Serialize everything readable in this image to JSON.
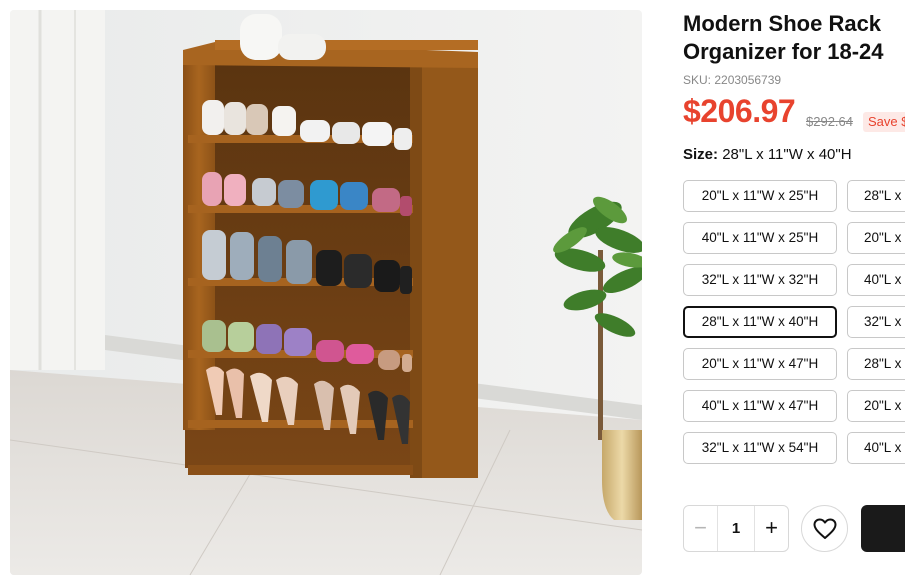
{
  "product": {
    "title_line1": "Modern Shoe Rack",
    "title_line2": "Organizer for 18-24",
    "sku": "SKU: 2203056739",
    "price": "$206.97",
    "original_price": "$292.64",
    "save_badge": "Save $",
    "image_alt": "Six-tier bamboo shoe rack filled with shoes"
  },
  "size": {
    "label": "Size:",
    "selected": "28\"L x 11\"W x 40\"H",
    "options": [
      {
        "label": "20\"L x 11\"W x 25\"H",
        "selected": false
      },
      {
        "label": "28\"L x",
        "selected": false
      },
      {
        "label": "40\"L x 11\"W x 25\"H",
        "selected": false
      },
      {
        "label": "20\"L x",
        "selected": false
      },
      {
        "label": "32\"L x 11\"W x 32\"H",
        "selected": false
      },
      {
        "label": "40\"L x",
        "selected": false
      },
      {
        "label": "28\"L x 11\"W x 40\"H",
        "selected": true
      },
      {
        "label": "32\"L x",
        "selected": false
      },
      {
        "label": "20\"L x 11\"W x 47\"H",
        "selected": false
      },
      {
        "label": "28\"L x",
        "selected": false
      },
      {
        "label": "40\"L x 11\"W x 47\"H",
        "selected": false
      },
      {
        "label": "20\"L x",
        "selected": false
      },
      {
        "label": "32\"L x 11\"W x 54\"H",
        "selected": false
      },
      {
        "label": "40\"L x",
        "selected": false
      }
    ]
  },
  "quantity": {
    "minus": "−",
    "value": "1",
    "plus": "+"
  },
  "icons": {
    "wishlist": "heart-icon",
    "minus": "minus-icon",
    "plus": "plus-icon"
  },
  "colors": {
    "price": "#e8432e",
    "save_badge_bg": "#fde9e6",
    "cart_button": "#1a1a1a",
    "selected_border": "#111111"
  }
}
